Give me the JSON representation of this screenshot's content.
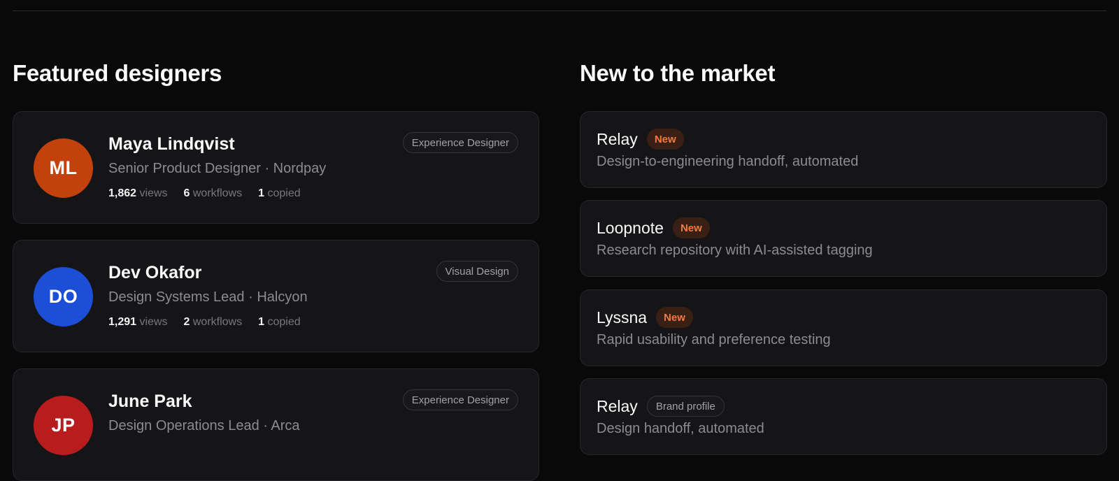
{
  "featured": {
    "title": "Featured designers",
    "designers": [
      {
        "initials": "ML",
        "avatar_color": "#c2410c",
        "name": "Maya Lindqvist",
        "role": "Senior Product Designer · Nordpay",
        "tag": "Experience Designer",
        "views_count": "1,862",
        "views_label": "views",
        "workflows_count": "6",
        "workflows_label": "workflows",
        "copied_count": "1",
        "copied_label": "copied"
      },
      {
        "initials": "DO",
        "avatar_color": "#1d4ed8",
        "name": "Dev Okafor",
        "role": "Design Systems Lead · Halcyon",
        "tag": "Visual Design",
        "views_count": "1,291",
        "views_label": "views",
        "workflows_count": "2",
        "workflows_label": "workflows",
        "copied_count": "1",
        "copied_label": "copied"
      },
      {
        "initials": "JP",
        "avatar_color": "#b91c1c",
        "name": "June Park",
        "role": "Design Operations Lead · Arca",
        "tag": "Experience Designer"
      }
    ]
  },
  "market": {
    "title": "New to the market",
    "items": [
      {
        "name": "Relay",
        "badge": "New",
        "badge_type": "new",
        "desc": "Design-to-engineering handoff, automated"
      },
      {
        "name": "Loopnote",
        "badge": "New",
        "badge_type": "new",
        "desc": "Research repository with AI-assisted tagging"
      },
      {
        "name": "Lyssna",
        "badge": "New",
        "badge_type": "new",
        "desc": "Rapid usability and preference testing"
      },
      {
        "name": "Relay",
        "badge": "Brand profile",
        "badge_type": "brand",
        "desc": "Design handoff, automated"
      }
    ]
  }
}
